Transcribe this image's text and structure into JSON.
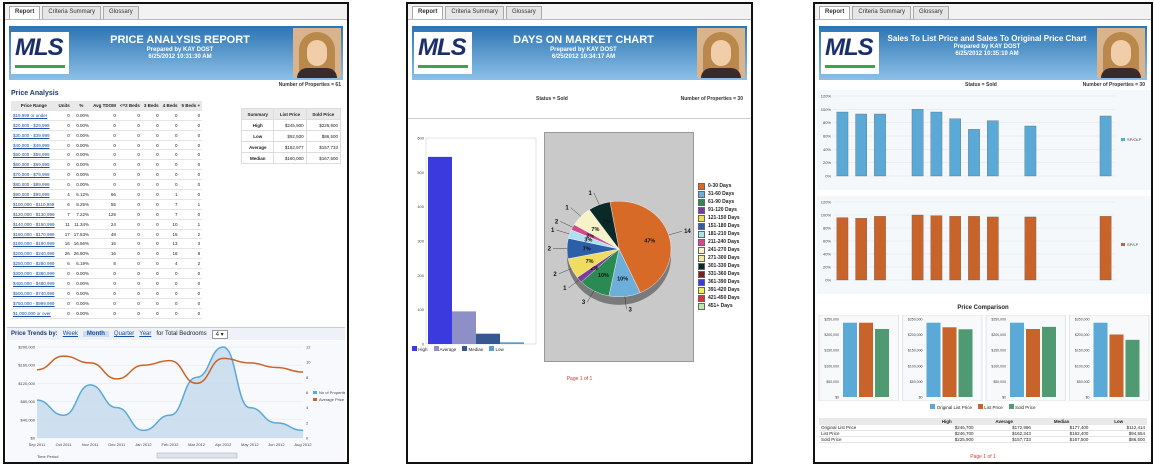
{
  "logo_text": "MLS",
  "panel1": {
    "tabs": [
      "Report",
      "Criteria Summary",
      "Glossary"
    ],
    "header_title": "PRICE ANALYSIS REPORT",
    "header_sub1": "Prepared by KAY DOST",
    "header_sub2": "6/25/2012 10:31:30 AM",
    "number_label": "Number of Properties = 61",
    "section_title": "Price Analysis",
    "columns": [
      "Price Range",
      "Units",
      "%",
      "Avg TDOM",
      "<=2 Beds",
      "3 Beds",
      "4 Beds",
      "5 Beds +"
    ],
    "rows": [
      [
        "$19,999 or under",
        "0",
        "0.00%",
        "0",
        "0",
        "0",
        "0",
        "0"
      ],
      [
        "$20,000 - $29,999",
        "0",
        "0.00%",
        "0",
        "0",
        "0",
        "0",
        "0"
      ],
      [
        "$30,000 - $39,999",
        "0",
        "0.00%",
        "0",
        "0",
        "0",
        "0",
        "0"
      ],
      [
        "$40,000 - $49,999",
        "0",
        "0.00%",
        "0",
        "0",
        "0",
        "0",
        "0"
      ],
      [
        "$50,000 - $59,999",
        "0",
        "0.00%",
        "0",
        "0",
        "0",
        "0",
        "0"
      ],
      [
        "$60,000 - $69,999",
        "0",
        "0.00%",
        "0",
        "0",
        "0",
        "0",
        "0"
      ],
      [
        "$70,000 - $79,999",
        "0",
        "0.00%",
        "0",
        "0",
        "0",
        "0",
        "0"
      ],
      [
        "$80,000 - $89,999",
        "0",
        "0.00%",
        "0",
        "0",
        "0",
        "0",
        "0"
      ],
      [
        "$90,000 - $99,999",
        "4",
        "6.12%",
        "66",
        "0",
        "0",
        "1",
        "0"
      ],
      [
        "$100,000 - $110,999",
        "6",
        "8.25%",
        "55",
        "0",
        "0",
        "7",
        "1"
      ],
      [
        "$120,000 - $130,999",
        "7",
        "7.22%",
        "129",
        "0",
        "0",
        "7",
        "0"
      ],
      [
        "$140,000 - $150,999",
        "11",
        "11.34%",
        "24",
        "0",
        "0",
        "10",
        "1"
      ],
      [
        "$160,000 - $170,999",
        "17",
        "17.53%",
        "48",
        "0",
        "0",
        "15",
        "2"
      ],
      [
        "$180,000 - $190,999",
        "16",
        "16.56%",
        "16",
        "0",
        "0",
        "13",
        "3"
      ],
      [
        "$200,000 - $240,999",
        "26",
        "26.80%",
        "16",
        "0",
        "0",
        "18",
        "8"
      ],
      [
        "$250,000 - $280,999",
        "6",
        "6.19%",
        "8",
        "0",
        "0",
        "4",
        "2"
      ],
      [
        "$300,000 - $380,999",
        "0",
        "0.00%",
        "0",
        "0",
        "0",
        "0",
        "0"
      ],
      [
        "$400,000 - $480,999",
        "0",
        "0.00%",
        "0",
        "0",
        "0",
        "0",
        "0"
      ],
      [
        "$500,000 - $740,999",
        "0",
        "0.00%",
        "0",
        "0",
        "0",
        "0",
        "0"
      ],
      [
        "$750,000 - $999,999",
        "0",
        "0.00%",
        "0",
        "0",
        "0",
        "0",
        "0"
      ],
      [
        "$1,000,000 or over",
        "0",
        "0.00%",
        "0",
        "0",
        "0",
        "0",
        "0"
      ]
    ],
    "summary": {
      "headers": [
        "Summary",
        "List Price",
        "Sold Price"
      ],
      "rows": [
        [
          "High",
          "$245,900",
          "$225,900"
        ],
        [
          "Low",
          "$92,500",
          "$86,500"
        ],
        [
          "Average",
          "$162,977",
          "$157,733"
        ],
        [
          "Median",
          "$160,000",
          "$167,500"
        ]
      ]
    },
    "trends": {
      "label": "Price Trends by:",
      "week": "Week",
      "month": "Month",
      "quarter": "Quarter",
      "year": "Year",
      "beds_label": "for Total Bedrooms",
      "beds_value": "4",
      "x_labels": [
        "Sep 2011",
        "Oct 2011",
        "Nov 2011",
        "Dec 2011",
        "Jan 2012",
        "Feb 2012",
        "Mar 2012",
        "Apr 2012",
        "May 2012",
        "Jun 2012",
        "Aug 2012"
      ],
      "y_left": [
        "$0",
        "$40,000",
        "$80,000",
        "$120,000",
        "$160,000",
        "$200,000"
      ],
      "y_right": [
        "0",
        "2",
        "4",
        "6",
        "8",
        "10",
        "12"
      ],
      "legend": [
        "No of Properties",
        "Average Price"
      ],
      "time_period": "Time Period"
    }
  },
  "panel2": {
    "tabs": [
      "Report",
      "Criteria Summary",
      "Glossary"
    ],
    "header_title": "DAYS ON MARKET CHART",
    "header_sub1": "Prepared by KAY DOST",
    "header_sub2": "6/25/2012 10:34:17 AM",
    "status": "Status = Sold",
    "number_label": "Number of Properties = 30",
    "bar_ticks": [
      "0",
      "100",
      "200",
      "300",
      "400",
      "500",
      "600"
    ],
    "bar_legend": [
      "High",
      "Average",
      "Median",
      "Low"
    ],
    "pie_legend": [
      "0-30 Days",
      "31-60 Days",
      "61-90 Days",
      "91-120 Days",
      "121-150 Days",
      "151-180 Days",
      "181-210 Days",
      "211-240 Days",
      "241-270 Days",
      "271-300 Days",
      "301-330 Days",
      "331-360 Days",
      "361-390 Days",
      "391-420 Days",
      "421-450 Days",
      "451+ Days"
    ],
    "pie_labels": [
      "47%",
      "10%",
      "10%",
      "2%",
      "7%",
      "7%",
      "3%",
      "2%",
      "7%",
      "7%"
    ],
    "pie_counts": [
      "14",
      "3",
      "3",
      "1",
      "2",
      "2",
      "1",
      "2",
      "1",
      "1"
    ],
    "page": "Page 1 of 1"
  },
  "panel3": {
    "tabs": [
      "Report",
      "Criteria Summary",
      "Glossary"
    ],
    "header_title": "Sales To List Price and Sales To Original Price Chart",
    "header_sub1": "Prepared by KAY DOST",
    "header_sub2": "6/25/2012 10:35:10 AM",
    "status": "Status = Sold",
    "number_label": "Number of Properties = 30",
    "legend_top": "SP/OLP",
    "legend_mid": "SP/LP",
    "comparison_title": "Price Comparison",
    "comp_legend": [
      "Original List Price",
      "List Price",
      "Sold Price"
    ],
    "table_headers": [
      "",
      "High",
      "Average",
      "Median",
      "Low"
    ],
    "table_rows": [
      [
        "Original List Price",
        "$246,700",
        "$172,996",
        "$177,400",
        "$112,414"
      ],
      [
        "List Price",
        "$246,700",
        "$162,343",
        "$162,400",
        "$94,554"
      ],
      [
        "Sold Price",
        "$225,900",
        "$157,733",
        "$167,500",
        "$86,500"
      ]
    ],
    "page": "Page 1 of 1"
  },
  "colors": {
    "header_blue": "#2c74b3",
    "bar_blue": "#5aa9d6",
    "bar_orange": "#c8642a",
    "bar_green": "#4f9a72",
    "navy": "#1b3a6b"
  },
  "chart_data": [
    {
      "type": "bar",
      "categories": [
        "High",
        "Average",
        "Median",
        "Low"
      ],
      "values": [
        545,
        95,
        30,
        5
      ],
      "ylim": [
        0,
        600
      ]
    },
    {
      "type": "pie",
      "labels": [
        "0-30 Days",
        "31-60 Days",
        "61-90 Days",
        "91-120 Days",
        "121-150 Days",
        "151-180 Days",
        "181-210 Days",
        "211-240 Days",
        "241-270 Days",
        "451+ Days"
      ],
      "values": [
        47,
        10,
        10,
        2,
        7,
        7,
        3,
        2,
        7,
        7
      ]
    },
    {
      "type": "bar",
      "series": [
        {
          "name": "SP/OLP",
          "values": [
            96,
            93,
            93,
            0,
            100,
            96,
            86,
            70,
            83,
            0,
            75,
            0,
            0,
            0,
            90
          ]
        }
      ],
      "ylim": [
        0,
        120
      ]
    },
    {
      "type": "bar",
      "series": [
        {
          "name": "SP/LP",
          "values": [
            96,
            95,
            98,
            0,
            100,
            99,
            98,
            98,
            97,
            0,
            97,
            0,
            0,
            0,
            98
          ]
        }
      ],
      "ylim": [
        0,
        120
      ]
    },
    {
      "type": "bar",
      "categories": [
        "High",
        "Average",
        "Median",
        "Low"
      ],
      "series": [
        {
          "name": "Original List Price",
          "values": [
            246700,
            172996,
            177400,
            112414
          ]
        },
        {
          "name": "List Price",
          "values": [
            246700,
            162343,
            162400,
            94554
          ]
        },
        {
          "name": "Sold Price",
          "values": [
            225900,
            157733,
            167500,
            86500
          ]
        }
      ]
    },
    {
      "type": "line",
      "series": [
        {
          "name": "No of Properties",
          "values": [
            5,
            3,
            7,
            4,
            1,
            3,
            8,
            12,
            4,
            2,
            1
          ]
        },
        {
          "name": "Average Price",
          "values": [
            150000,
            180000,
            165000,
            130000,
            160000,
            170000,
            120000,
            175000,
            165000,
            155000,
            145000
          ]
        }
      ]
    }
  ]
}
